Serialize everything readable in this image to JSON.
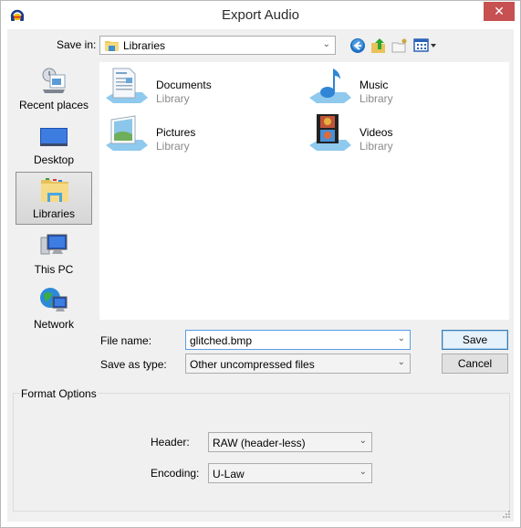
{
  "window": {
    "title": "Export Audio",
    "close_label": "✕"
  },
  "toolbar": {
    "save_in_label": "Save in:",
    "save_in_value": "Libraries",
    "icons": [
      "back-icon",
      "up-folder-icon",
      "new-folder-icon",
      "view-menu-icon"
    ]
  },
  "places": [
    {
      "label": "Recent places",
      "icon": "recent-places-icon",
      "selected": false
    },
    {
      "label": "Desktop",
      "icon": "desktop-icon",
      "selected": false
    },
    {
      "label": "Libraries",
      "icon": "libraries-icon",
      "selected": true
    },
    {
      "label": "This PC",
      "icon": "this-pc-icon",
      "selected": false
    },
    {
      "label": "Network",
      "icon": "network-icon",
      "selected": false
    }
  ],
  "libraries": [
    {
      "name": "Documents",
      "type": "Library",
      "icon": "documents-icon"
    },
    {
      "name": "Music",
      "type": "Library",
      "icon": "music-icon"
    },
    {
      "name": "Pictures",
      "type": "Library",
      "icon": "pictures-icon"
    },
    {
      "name": "Videos",
      "type": "Library",
      "icon": "videos-icon"
    }
  ],
  "form": {
    "file_name_label": "File name:",
    "file_name_value": "glitched.bmp",
    "save_as_type_label": "Save as type:",
    "save_as_type_value": "Other uncompressed files",
    "save_button": "Save",
    "cancel_button": "Cancel"
  },
  "format_options": {
    "title": "Format Options",
    "header_label": "Header:",
    "header_value": "RAW (header-less)",
    "encoding_label": "Encoding:",
    "encoding_value": "U-Law"
  },
  "colors": {
    "close_button": "#c75050",
    "focus_border": "#569de5",
    "dialog_bg": "#f0f0f0"
  }
}
